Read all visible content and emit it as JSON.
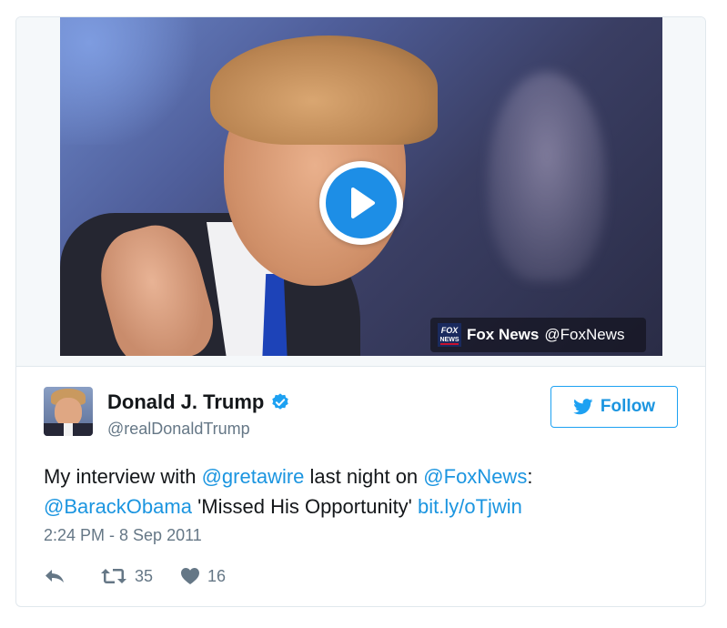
{
  "media": {
    "source_name": "Fox News",
    "source_handle": "@FoxNews",
    "source_logo_text": "FOX NEWS"
  },
  "author": {
    "display_name": "Donald J. Trump",
    "username": "@realDonaldTrump",
    "verified": true
  },
  "follow_button": {
    "label": "Follow"
  },
  "tweet": {
    "text_parts": {
      "p1": "My interview with ",
      "m1": "@gretawire",
      "p2": " last night on ",
      "m2": "@FoxNews",
      "p3": ":",
      "m3": "@BarackObama",
      "p4": " 'Missed His Opportunity' ",
      "link": "bit.ly/oTjwin"
    },
    "timestamp": "2:24 PM - 8 Sep 2011"
  },
  "actions": {
    "retweets": "35",
    "likes": "16"
  },
  "colors": {
    "link": "#1b95e0",
    "muted": "#657786",
    "play_blue": "#1d8ee6",
    "verified_blue": "#1da1f2"
  }
}
